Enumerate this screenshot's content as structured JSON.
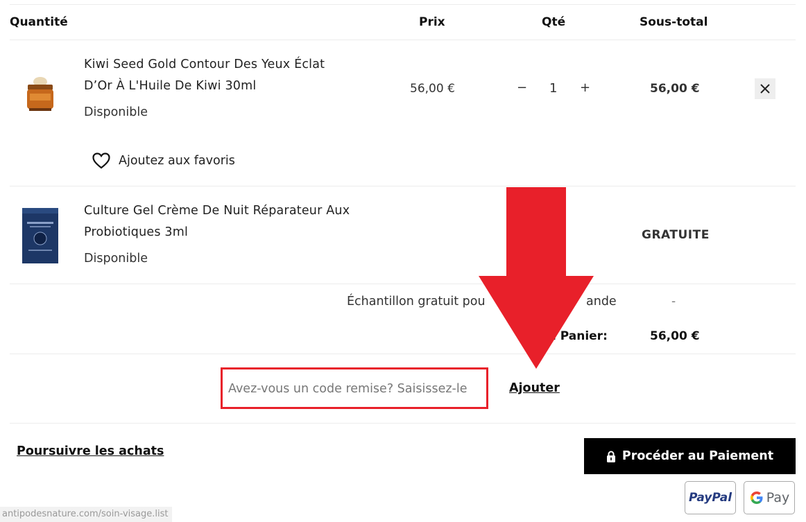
{
  "table": {
    "headers": {
      "quantity": "Quantité",
      "price": "Prix",
      "qty": "Qté",
      "subtotal": "Sous-total"
    }
  },
  "items": [
    {
      "title_line1": "Kiwi Seed Gold Contour Des Yeux Éclat",
      "title_line2": "D’Or À L'Huile De Kiwi 30ml",
      "availability": "Disponible",
      "price": "56,00 €",
      "quantity": "1",
      "minus": "−",
      "plus": "+",
      "subtotal": "56,00 €",
      "favorite_label": "Ajoutez aux favoris"
    },
    {
      "title_line1": "Culture Gel Crème De Nuit Réparateur Aux",
      "title_line2": "Probiotiques 3ml",
      "availability": "Disponible",
      "subtotal": "GRATUITE"
    }
  ],
  "summary": {
    "sample_label": "Échantillon gratuit pou",
    "sample_label_tail": "ande",
    "sample_value": "-",
    "total_label": "l Panier:",
    "total_value": "56,00 €"
  },
  "coupon": {
    "placeholder": "Avez-vous un code remise? Saisissez-le",
    "submit_label": "Ajouter"
  },
  "footer": {
    "continue_label": "Poursuivre les achats",
    "checkout_label": "Procéder au Paiement",
    "paypal_label": "PayPal",
    "gpay_label": "Pay"
  },
  "status_url": "antipodesnature.com/soin-visage.list",
  "colors": {
    "annotation_red": "#e8202a",
    "checkout_bg": "#000000",
    "paypal_dark": "#253b80",
    "paypal_light": "#179bd7"
  },
  "icons": [
    "heart-icon",
    "close-icon",
    "lock-icon",
    "google-g-icon",
    "down-arrow-annotation"
  ]
}
